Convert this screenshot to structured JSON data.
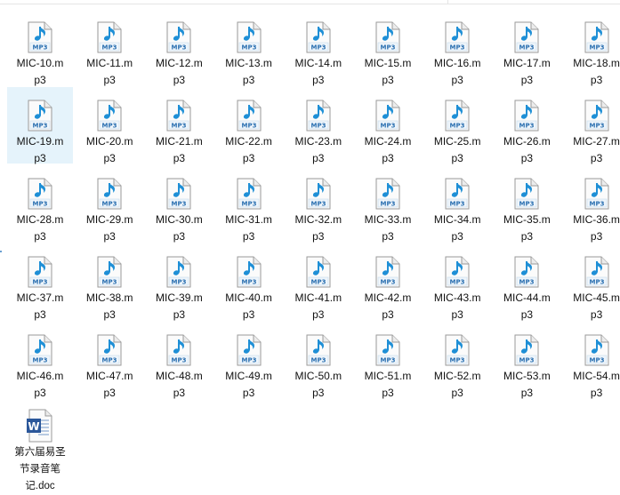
{
  "explorer": {
    "files": [
      {
        "line1": "MIC-10.m",
        "line2": "p3",
        "type": "mp3"
      },
      {
        "line1": "MIC-11.m",
        "line2": "p3",
        "type": "mp3"
      },
      {
        "line1": "MIC-12.m",
        "line2": "p3",
        "type": "mp3"
      },
      {
        "line1": "MIC-13.m",
        "line2": "p3",
        "type": "mp3"
      },
      {
        "line1": "MIC-14.m",
        "line2": "p3",
        "type": "mp3"
      },
      {
        "line1": "MIC-15.m",
        "line2": "p3",
        "type": "mp3"
      },
      {
        "line1": "MIC-16.m",
        "line2": "p3",
        "type": "mp3"
      },
      {
        "line1": "MIC-17.m",
        "line2": "p3",
        "type": "mp3"
      },
      {
        "line1": "MIC-18.m",
        "line2": "p3",
        "type": "mp3"
      },
      {
        "line1": "MIC-19.m",
        "line2": "p3",
        "type": "mp3",
        "selected": true
      },
      {
        "line1": "MIC-20.m",
        "line2": "p3",
        "type": "mp3"
      },
      {
        "line1": "MIC-21.m",
        "line2": "p3",
        "type": "mp3"
      },
      {
        "line1": "MIC-22.m",
        "line2": "p3",
        "type": "mp3"
      },
      {
        "line1": "MIC-23.m",
        "line2": "p3",
        "type": "mp3"
      },
      {
        "line1": "MIC-24.m",
        "line2": "p3",
        "type": "mp3"
      },
      {
        "line1": "MIC-25.m",
        "line2": "p3",
        "type": "mp3"
      },
      {
        "line1": "MIC-26.m",
        "line2": "p3",
        "type": "mp3"
      },
      {
        "line1": "MIC-27.m",
        "line2": "p3",
        "type": "mp3"
      },
      {
        "line1": "MIC-28.m",
        "line2": "p3",
        "type": "mp3"
      },
      {
        "line1": "MIC-29.m",
        "line2": "p3",
        "type": "mp3"
      },
      {
        "line1": "MIC-30.m",
        "line2": "p3",
        "type": "mp3"
      },
      {
        "line1": "MIC-31.m",
        "line2": "p3",
        "type": "mp3"
      },
      {
        "line1": "MIC-32.m",
        "line2": "p3",
        "type": "mp3"
      },
      {
        "line1": "MIC-33.m",
        "line2": "p3",
        "type": "mp3"
      },
      {
        "line1": "MIC-34.m",
        "line2": "p3",
        "type": "mp3"
      },
      {
        "line1": "MIC-35.m",
        "line2": "p3",
        "type": "mp3"
      },
      {
        "line1": "MIC-36.m",
        "line2": "p3",
        "type": "mp3"
      },
      {
        "line1": "MIC-37.m",
        "line2": "p3",
        "type": "mp3"
      },
      {
        "line1": "MIC-38.m",
        "line2": "p3",
        "type": "mp3"
      },
      {
        "line1": "MIC-39.m",
        "line2": "p3",
        "type": "mp3"
      },
      {
        "line1": "MIC-40.m",
        "line2": "p3",
        "type": "mp3"
      },
      {
        "line1": "MIC-41.m",
        "line2": "p3",
        "type": "mp3"
      },
      {
        "line1": "MIC-42.m",
        "line2": "p3",
        "type": "mp3"
      },
      {
        "line1": "MIC-43.m",
        "line2": "p3",
        "type": "mp3"
      },
      {
        "line1": "MIC-44.m",
        "line2": "p3",
        "type": "mp3"
      },
      {
        "line1": "MIC-45.m",
        "line2": "p3",
        "type": "mp3"
      },
      {
        "line1": "MIC-46.m",
        "line2": "p3",
        "type": "mp3"
      },
      {
        "line1": "MIC-47.m",
        "line2": "p3",
        "type": "mp3"
      },
      {
        "line1": "MIC-48.m",
        "line2": "p3",
        "type": "mp3"
      },
      {
        "line1": "MIC-49.m",
        "line2": "p3",
        "type": "mp3"
      },
      {
        "line1": "MIC-50.m",
        "line2": "p3",
        "type": "mp3"
      },
      {
        "line1": "MIC-51.m",
        "line2": "p3",
        "type": "mp3"
      },
      {
        "line1": "MIC-52.m",
        "line2": "p3",
        "type": "mp3"
      },
      {
        "line1": "MIC-53.m",
        "line2": "p3",
        "type": "mp3"
      },
      {
        "line1": "MIC-54.m",
        "line2": "p3",
        "type": "mp3"
      },
      {
        "line1": "第六届易圣",
        "line2": "节录音笔",
        "line3": "记.doc",
        "type": "doc"
      }
    ],
    "icons": {
      "mp3": "mp3-file-icon",
      "doc": "word-document-icon",
      "mp3_badge": "MP3",
      "doc_badge": "W"
    },
    "colors": {
      "selection": "#e5f3fb",
      "note_blue": "#1e8fd6",
      "word_blue": "#2b579a"
    }
  }
}
